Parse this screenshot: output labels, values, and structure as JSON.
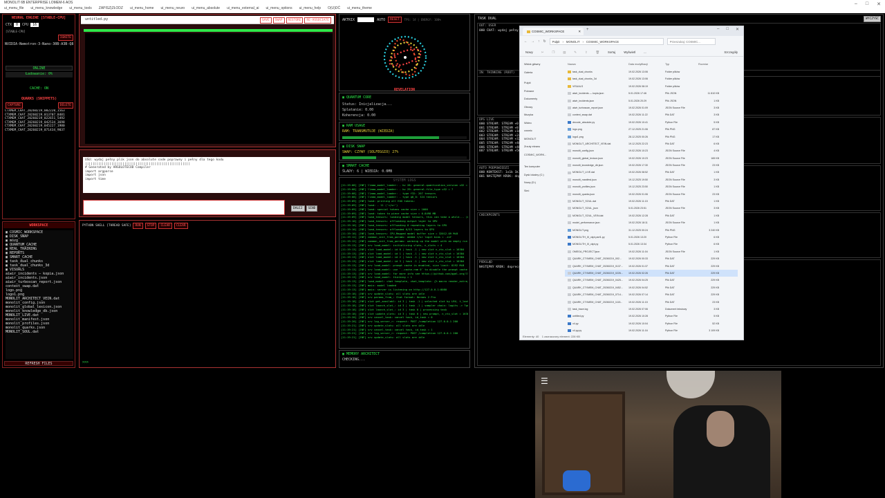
{
  "window": {
    "title": "MONOLIT 6B ENTERPRISE LOMEM-6 AOS",
    "menu": [
      "ui_menu_file",
      "ui_menu_knowledge",
      "ui_menu_tools",
      "ZAPISZ|ZŁODZ",
      "ui_menu_home",
      "ui_menu_neuro",
      "ui_menu_absolute",
      "ui_menu_external_ai",
      "ui_menu_options",
      "ui_menu_help",
      "O(U)DĆ",
      "ui_menu_theme"
    ],
    "controls": [
      "–",
      "□",
      "✕"
    ]
  },
  "left": {
    "engine_title": "NEURAL ENGINE [STABLE-CPU]",
    "ctx_label": "CTX",
    "ctx_value": "0",
    "cpu_label": "CPU",
    "cpu_value": "16",
    "stable_tag": "[STABLE-CPU]",
    "ignite": "IGNITE",
    "model": "NVIDIA-Nemotron-3-Nano-30B-A3B-Q8",
    "online": "ONLINE",
    "loading": "Ładowanie: 0%",
    "cache": "CACHE: ON",
    "quarks_title": "QUARKS (SNIPPETS)",
    "capture": "CAPTURE",
    "delete": "DELETE",
    "quarks": [
      "CTXMEM_CHAT_20260219_002220_1563",
      "CTXMEM_CHAT_20260219_013707_8481",
      "CTXMEM_CHAT_20260219_022651_5492",
      "CTXMEM_CHAT_20260219_042534_3698",
      "CTXMEM_CHAT_20260219_045227_1980",
      "CTXMEM_CHAT_20260219_071434_9037"
    ],
    "workspace_title": "WORKSPACE",
    "tree": [
      "▣ COSMIC_WORKSPACE",
      "  ▣ DISK_SWAP",
      "  ▣ mózg",
      "  ▣ QUANTUM_CACHE",
      "  ▣ REAL_TRAINING",
      "  ▣ REPORTS",
      "  ▣ SMART_CACHE",
      "  ▣ task_dual_chunks",
      "  ▣ task_dual_chunks_3d",
      "  ▣ VISUALS",
      "    aiwir_incidents — kopia.json",
      "    aiwir_incidents.json",
      "    aiwir_turboscan_report.json",
      "    context_swap.dat",
      "    logo.png",
      "    logo1.png",
      "    MONOLIT_ARCHITECT_VEIN.dat",
      "    monolit_config.json",
      "    monolit_global_lexicon.json",
      "    monolit_knowledge_db.json",
      "    MONOLIT_LIVE.dat",
      "    monolit_manifest.json",
      "    monolit_profiles.json",
      "    monolit_quarks.json",
      "    MONOLIT_SOUL.dat"
    ],
    "refresh": "REFRESH FILES"
  },
  "editor": {
    "tab": "untitled.py",
    "buttons": [
      "SAVE",
      "SWAP",
      "RESTORE",
      "RE-ASSOCIATE"
    ],
    "prompt_lines": [
      "USU: wydaj pełny plik json do absolute code poprawny i pełny dla tego kodu",
      "||||||||||||||||||||||||||||||||||||||||||||||||||||||||",
      "# Generated by ARGOLOTECOD Compiler",
      "import argparse",
      "import json",
      "import time"
    ],
    "send": "SEND",
    "dalej": "DALEJ",
    "shell_title": "PYTHON SHELL [THREAD SAFE]",
    "shell_btns": [
      "RUN",
      "STOP",
      "CLEAR",
      "CLEAR"
    ],
    "shell_prompt": ">>>"
  },
  "mid": {
    "aktrix": "AKTRIX",
    "auto": "AUTO",
    "reset": "RESET",
    "stats": "TPS: 14 | ENERGY: 100%",
    "revelation": "REVELATION",
    "quantum_title": "QUANTUM CORE",
    "quantum_lines": [
      "Status: Inicjalizacja...",
      "Splatanie: 0.00",
      "Koherencja: 0.00"
    ],
    "ram_title": "RAM USAGE",
    "ram_line": "RAM: TRANSMUTUJE (WIEDZA)",
    "ram_fill": 0.78,
    "disk_title": "DISK SWAP",
    "disk_line": "SWAP: CZYWY (SOLFEGGIO) 27%",
    "disk_fill": 0.27,
    "smart_title": "SMART CACHE",
    "smart_line": "ŚLADY: 6 | WIEDZA: 0.0MB",
    "syslog_title": "SYSTEM LOGS",
    "syslog": [
      "[11:19:08] [INF] llama_model_loader: - kv  28:                 general.quantization_version u32 = 2",
      "[11:19:08] [INF] llama_model_loader: - kv  29:                 general.file_type u32 = 7",
      "[11:19:08] [INF] llama_model_loader: - type  f32:  207 tensors",
      "[11:19:08] [INF] llama_model_loader: - type q8_0:  324 tensors",
      "[11:19:09] [INF] load: printing all EOG tokens:",
      "[11:19:09] [INF] load:   - 11 ('</s>')",
      "[11:19:09] [INF] load: special tokens cache size = 1000",
      "[11:19:09] [INF] load: token to piece cache size = 0.8498 MB",
      "[11:19:09] [INF] load_tensors: loading model tensors, this can take a while... (mmap = true)",
      "[11:19:10] [INF] load_tensors: offloading output layer to GPU",
      "[11:19:10] [INF] load_tensors: offloading 0 repeating layers to GPU",
      "[11:19:10] [INF] load_tensors: offloaded 0/53 layers to GPU",
      "[11:19:10] [INF] load_tensors:   CPU_Mapped model buffer size = 32012.09 MiB",
      "[11:19:12] [INF] common_init_from_params: added </s> logit bias = -inf",
      "[11:19:12] [INF] common_init_from_params: warming up the model with an empty run - please wait ... (--no-warmup to disable)",
      "[11:19:13] [INF] srv  load_model: initializing slots, n_slots = 4",
      "[11:19:13] [INF] slot load_model: id  0 | task -1 | new slot n_ctx_slot = 16384",
      "[11:19:13] [INF] slot load_model: id  1 | task -1 | new slot n_ctx_slot = 16384",
      "[11:19:13] [INF] slot load_model: id  2 | task -1 | new slot n_ctx_slot = 16384",
      "[11:19:13] [INF] slot load_model: id  3 | task -1 | new slot n_ctx_slot = 16384",
      "[11:19:13] [INF] srv  load_model: prompt cache is enabled, size limit: 8192 MiB",
      "[11:19:13] [INF] srv  load_model: use `--cache-ram 0` to disable the prompt cache",
      "[11:19:13] [INF] srv  load_model: for more info see https://github.com/ggml-org/llama.cpp/pull/16391",
      "[11:19:13] [INF] srv  load_model: thinking = 1",
      "[11:19:13] [INF] load_model: chat template, chat_template: {% macro render_extra_keys(json_dict, handled_keys) %}",
      "[11:19:13] [INF] main: model loaded",
      "[11:19:13] [INF] main: server is listening on http://127.0.0.1:8080",
      "[11:19:18] [INF] srv  update_slots: all slots are idle",
      "[11:19:18] [INF] srv  params_from_: Chat format: Hermes 2 Pro",
      "[11:19:18] [INF] slot get_availabl: id  3 | task -1 | selected slot by LRU, t_last = -1",
      "[11:19:18] [INF] slot launch_slot_: id  3 | task -1 | sampler chain: logits -> ?penalties -> ?dry -> ?top-n-sigma",
      "[11:19:18] [INF] slot launch_slot_: id  3 | task 0 | processing task",
      "[11:19:18] [INF] slot update_slots: id  3 | task 0 | new prompt, n_ctx_slot = 16384, n_keep = 0, task.n_tokens = 3567",
      "[11:19:20] [INF] srv    cancel_task: cancel task, id_task = 0",
      "[11:19:20] [INF] srv  log_server_r: request: POST /completion 127.0.0.1 200",
      "[11:19:21] [INF] srv  update_slots: all slots are idle",
      "[11:19:21] [INF] srv    cancel_task: cancel task, id_task = 1",
      "[11:19:21] [INF] srv  log_server_r: request: POST /completion 127.0.0.1 200",
      "[11:19:21] [INF] srv  update_slots: all slots are idle"
    ],
    "architect_title": "MEMORY ARCHITECT",
    "architect_line": "CHECKING..."
  },
  "right": {
    "task_title": "TASK DUAL",
    "task_btn": "WYCZYŚĆ",
    "out_label": "OUT: USER",
    "out_line": "000 CHAT: wydaj pełny plik json do absolute code poprawny",
    "thinking_label": "IN: THINKING (ROOT)",
    "ops_label": "OPS LIVE",
    "ops_lines": [
      "000 STREAM: STREAM +0",
      "001 STREAM: STREAM +8",
      "002 STREAM: STREAM +16",
      "003 STREAM: STREAM +24",
      "004 STREAM: STREAM +32",
      "005 STREAM: STREAM +40",
      "006 STREAM: STREAM +48",
      "007 STREAM: STREAM +56"
    ],
    "auto_label": "AUTO PODPOWIEDZI",
    "auto_lines": [
      "000 KONTEKST: 1x1b 1k1 ...",
      "001 NASTĘPNY KROK: dopr..."
    ],
    "checkpoints": "CHECKPOINTS",
    "podglad": "PODGLĄD",
    "podglad_line": "NASTĘPNY KROK: doprecyzuj ..."
  },
  "explorer": {
    "tab_title": "COSMIC_WORKSPACE",
    "path": [
      "Pulpit",
      "MONOLIT",
      "COSMIC_WORKSPACE"
    ],
    "search_placeholder": "Przeszukaj: COSMIC...",
    "toolbar": [
      "Nowy",
      "Sortuj",
      "Wyświetl",
      "...",
      "Szczegóły"
    ],
    "nav": [
      "Widok główny",
      "Galeria",
      "Pulpit",
      "Pobrane",
      "Dokumenty",
      "Obrazy",
      "Muzyka",
      "Wideo",
      "cosmic",
      "MONOLIT",
      "Zrzuty ekranu",
      "COSMIC_WORK...",
      "Ten komputer",
      "Dysk lokalny (C:)",
      "Nowy (D:)",
      "Sieć"
    ],
    "columns": [
      "Nazwa",
      "Data modyfikacji",
      "Typ",
      "Rozmiar"
    ],
    "files": [
      [
        "task_dual_chunks",
        "19.02.2026 13:06",
        "Folder plików",
        ""
      ],
      [
        "task_dual_chunks_3d",
        "19.02.2026 13:06",
        "Folder plików",
        ""
      ],
      [
        "VISUALS",
        "19.02.2026 08:19",
        "Folder plików",
        ""
      ],
      [
        "aiwir_incidents — kopia.json",
        "5.01.2026 17:46",
        "Plik JSON",
        "11 810 KB"
      ],
      [
        "aiwir_incidents.json",
        "5.01.2026 20:29",
        "Plik JSON",
        "1 KB"
      ],
      [
        "aiwir_turboscan_report.json",
        "19.02.2026 01:09",
        "JSON Source File",
        "3 KB"
      ],
      [
        "context_swap.dat",
        "19.02.2026 11:22",
        "Plik DAT",
        "3 KB"
      ],
      [
        "decode_absolute.py",
        "19.02.2026 10:41",
        "Python File",
        "5 KB"
      ],
      [
        "logo.png",
        "27.12.2025 21:06",
        "Plik PNG",
        "87 KB"
      ],
      [
        "logo1.png",
        "28.12.2025 00:26",
        "Plik PNG",
        "17 KB"
      ],
      [
        "MONOLIT_ARCHITECT_VEIN.dat",
        "19.12.2025 22:23",
        "Plik DAT",
        "6 KB"
      ],
      [
        "monolit_config.json",
        "19.02.2026 10:23",
        "JSON Source File",
        "4 KB"
      ],
      [
        "monolit_global_lexicon.json",
        "19.02.2026 10:23",
        "JSON Source File",
        "165 KB"
      ],
      [
        "monolit_knowledge_db.json",
        "19.02.2026 17:30",
        "JSON Source File",
        "23 KB"
      ],
      [
        "MONOLIT_LIVE.dat",
        "19.02.2026 08:52",
        "Plik DAT",
        "1 KB"
      ],
      [
        "monolit_manifest.json",
        "19.12.2025 19:50",
        "JSON Source File",
        "3 KB"
      ],
      [
        "monolit_profiles.json",
        "19.12.2025 23:50",
        "JSON Source File",
        "1 KB"
      ],
      [
        "monolit_quarks.json",
        "19.02.2026 01:06",
        "JSON Source File",
        "23 KB"
      ],
      [
        "MONOLIT_SOUL.dat",
        "19.02.2026 11:15",
        "Plik DAT",
        "1 KB"
      ],
      [
        "MONOLIT_SOUL_json",
        "5.01.2026 23:51",
        "JSON Source File",
        "3 KB"
      ],
      [
        "MONOLIT_SOUL_VEIN.dat",
        "19.02.2026 12:28",
        "Plik DAT",
        "1 KB"
      ],
      [
        "model_performance.json",
        "19.02.2026 18:11",
        "JSON Source File",
        "1 KB"
      ],
      [
        "MONOLIT.png",
        "31.12.2025 00:24",
        "Plik PNG",
        "3 240 KB"
      ],
      [
        "MONOLITH_III_ckpt.part1.py",
        "5.01.2026 13:20",
        "Python File",
        "6 KB"
      ],
      [
        "MONOLITH_III_ckpt.py",
        "5.01.2026 13:34",
        "Python File",
        "6 KB"
      ],
      [
        "OMEGA_PROJECT.json",
        "19.02.2026 11:04",
        "JSON Source File",
        "1 KB"
      ],
      [
        "QUARK_CTXMEM_CHAT_20260219_002...",
        "19.02.2026 00:33",
        "Plik DAT",
        "229 KB"
      ],
      [
        "QUARK_CTXMEM_CHAT_20260219_0137...",
        "19.02.2026 01:37",
        "Plik DAT",
        "229 KB"
      ],
      [
        "QUARK_CTXMEM_CHAT_20260219_0226...",
        "19.02.2026 02:26",
        "Plik DAT",
        "229 KB"
      ],
      [
        "QUARK_CTXMEM_CHAT_20260219_0425...",
        "19.02.2026 04:25",
        "Plik DAT",
        "229 KB"
      ],
      [
        "QUARK_CTXMEM_CHAT_20260219_0452...",
        "19.02.2026 04:52",
        "Plik DAT",
        "229 KB"
      ],
      [
        "QUARK_CTXMEM_CHAT_20260219_0714...",
        "19.02.2026 07:14",
        "Plik DAT",
        "229 KB"
      ],
      [
        "QUARK_CTXMEM_CHAT_20260219_1115...",
        "19.02.2026 11:15",
        "Plik DAT",
        "23 KB"
      ],
      [
        "task_trace.log",
        "19.02.2026 07:06",
        "Dokument tekstowy",
        "3 KB"
      ],
      [
        "untitled.py",
        "19.02.2026 10:28",
        "Python File",
        "5 KB"
      ],
      [
        "x4.py",
        "19.02.2026 10:04",
        "Python File",
        "52 KB"
      ],
      [
        "x4.py.py",
        "19.02.2026 11:16",
        "Python File",
        "3 109 KB"
      ]
    ],
    "selected_index": 28,
    "status": "Elementy: 40    1 zaznaczony element: 228 KB"
  },
  "webcam": {
    "menu_icon": "hamburger-icon"
  },
  "colors": {
    "accent_red": "#ff4444",
    "accent_green": "#2ee84a",
    "panel_border": "#aa3333"
  }
}
